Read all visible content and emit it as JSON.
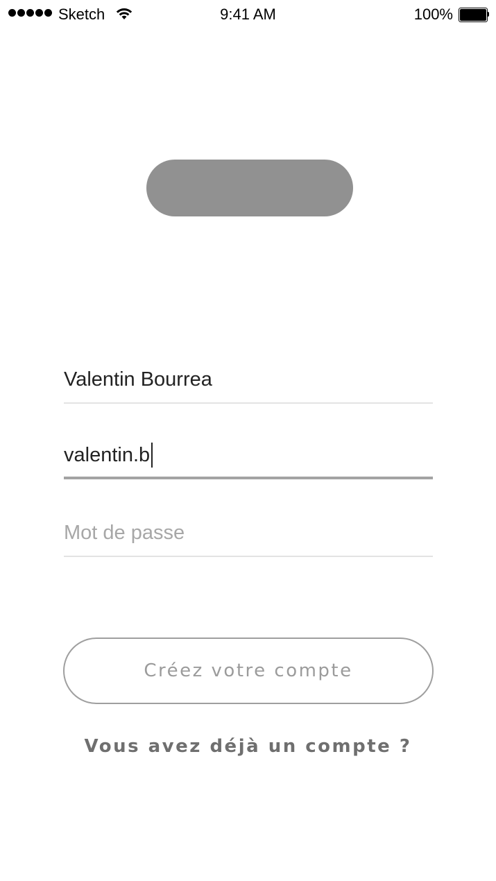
{
  "status_bar": {
    "carrier": "Sketch",
    "time": "9:41 AM",
    "battery_percent": "100%",
    "battery_level": 1.0,
    "signal_bars": 5,
    "icons": [
      "signal-dots-icon",
      "wifi-icon",
      "battery-icon"
    ]
  },
  "logo": {
    "color": "#919191"
  },
  "form": {
    "name_value": "Valentin Bourrea",
    "email_value": "valentin.b",
    "password_placeholder": "Mot de passe"
  },
  "actions": {
    "create_account_label": "Créez votre compte",
    "login_link_label": "Vous avez déjà un compte ?"
  },
  "colors": {
    "placeholder": "#a7a7a7",
    "active_underline": "#a3a3a3",
    "button_text": "#9b9b9b",
    "link_text": "#6f6f6f"
  }
}
